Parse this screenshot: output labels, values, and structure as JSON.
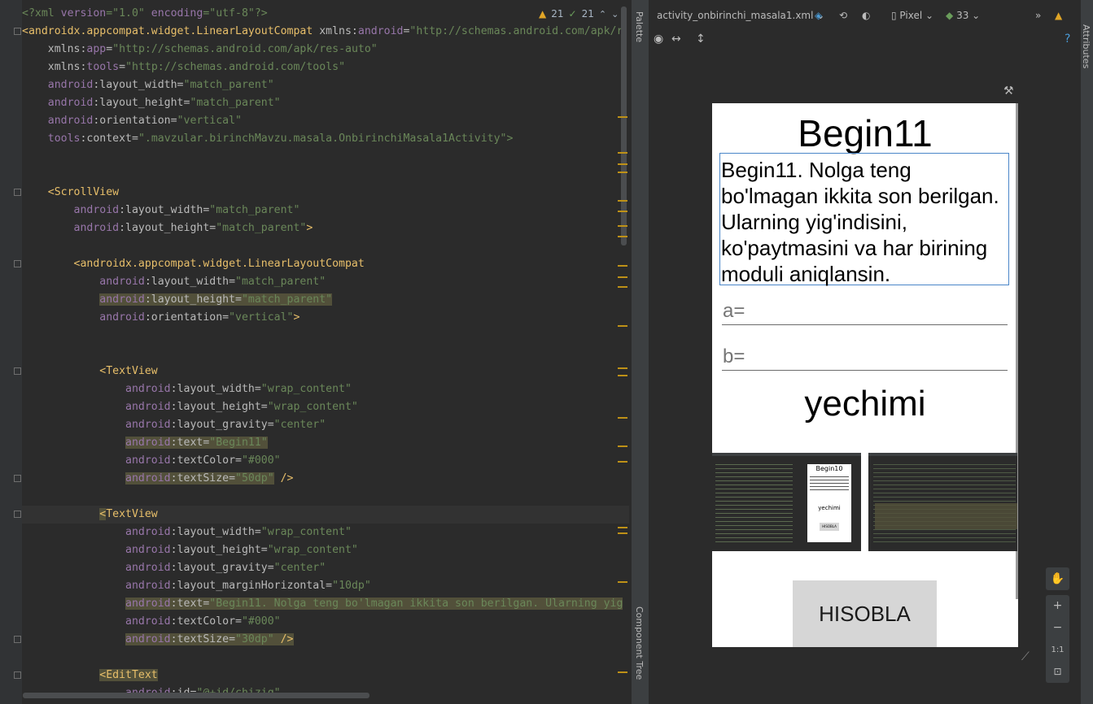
{
  "editor": {
    "warnings_count": "21",
    "weak_warnings_count": "21",
    "lines": [
      [
        [
          "t-str",
          "<?xml "
        ],
        [
          "t-ns",
          "version"
        ],
        [
          "t-str",
          "=\"1.0\" "
        ],
        [
          "t-ns",
          "encoding"
        ],
        [
          "t-str",
          "=\"utf-8\"?>"
        ]
      ],
      [
        [
          "t-tag",
          "<androidx.appcompat.widget.LinearLayoutCompat "
        ],
        [
          "t-attr",
          "xmlns:"
        ],
        [
          "t-ns",
          "android"
        ],
        [
          "t-attr",
          "="
        ],
        [
          "t-str",
          "\"http://schemas.android.com/apk/r"
        ]
      ],
      [
        [
          "t-plain",
          "    "
        ],
        [
          "t-attr",
          "xmlns:"
        ],
        [
          "t-ns",
          "app"
        ],
        [
          "t-attr",
          "="
        ],
        [
          "t-str",
          "\"http://schemas.android.com/apk/res-auto\""
        ]
      ],
      [
        [
          "t-plain",
          "    "
        ],
        [
          "t-attr",
          "xmlns:"
        ],
        [
          "t-ns",
          "tools"
        ],
        [
          "t-attr",
          "="
        ],
        [
          "t-str",
          "\"http://schemas.android.com/tools\""
        ]
      ],
      [
        [
          "t-plain",
          "    "
        ],
        [
          "t-ns",
          "android"
        ],
        [
          "t-attr",
          ":layout_width="
        ],
        [
          "t-str",
          "\"match_parent\""
        ]
      ],
      [
        [
          "t-plain",
          "    "
        ],
        [
          "t-ns",
          "android"
        ],
        [
          "t-attr",
          ":layout_height="
        ],
        [
          "t-str",
          "\"match_parent\""
        ]
      ],
      [
        [
          "t-plain",
          "    "
        ],
        [
          "t-ns",
          "android"
        ],
        [
          "t-attr",
          ":orientation="
        ],
        [
          "t-str",
          "\"vertical\""
        ]
      ],
      [
        [
          "t-plain",
          "    "
        ],
        [
          "t-ns",
          "tools"
        ],
        [
          "t-attr",
          ":context="
        ],
        [
          "t-str",
          "\".mavzular.birinchMavzu.masala.OnbirinchiMasala1Activity\">"
        ]
      ],
      [],
      [],
      [
        [
          "t-plain",
          "    "
        ],
        [
          "t-tag",
          "<ScrollView"
        ]
      ],
      [
        [
          "t-plain",
          "        "
        ],
        [
          "t-ns",
          "android"
        ],
        [
          "t-attr",
          ":layout_width="
        ],
        [
          "t-str",
          "\"match_parent\""
        ]
      ],
      [
        [
          "t-plain",
          "        "
        ],
        [
          "t-ns",
          "android"
        ],
        [
          "t-attr",
          ":layout_height="
        ],
        [
          "t-str",
          "\"match_parent\""
        ],
        [
          "t-tag",
          ">"
        ]
      ],
      [],
      [
        [
          "t-plain",
          "        "
        ],
        [
          "t-tag",
          "<androidx.appcompat.widget.LinearLayoutCompat"
        ]
      ],
      [
        [
          "t-plain",
          "            "
        ],
        [
          "t-ns",
          "android"
        ],
        [
          "t-attr",
          ":layout_width="
        ],
        [
          "t-str",
          "\"match_parent\""
        ]
      ],
      [
        [
          "t-plain",
          "            "
        ],
        [
          "t-ns hl",
          "android"
        ],
        [
          "t-attr hl",
          ":layout_height="
        ],
        [
          "t-str hl",
          "\"match_parent\""
        ]
      ],
      [
        [
          "t-plain",
          "            "
        ],
        [
          "t-ns",
          "android"
        ],
        [
          "t-attr",
          ":orientation="
        ],
        [
          "t-str",
          "\"vertical\""
        ],
        [
          "t-tag",
          ">"
        ]
      ],
      [],
      [],
      [
        [
          "t-plain",
          "            "
        ],
        [
          "t-tag",
          "<TextView"
        ]
      ],
      [
        [
          "t-plain",
          "                "
        ],
        [
          "t-ns",
          "android"
        ],
        [
          "t-attr",
          ":layout_width="
        ],
        [
          "t-str",
          "\"wrap_content\""
        ]
      ],
      [
        [
          "t-plain",
          "                "
        ],
        [
          "t-ns",
          "android"
        ],
        [
          "t-attr",
          ":layout_height="
        ],
        [
          "t-str",
          "\"wrap_content\""
        ]
      ],
      [
        [
          "t-plain",
          "                "
        ],
        [
          "t-ns",
          "android"
        ],
        [
          "t-attr",
          ":layout_gravity="
        ],
        [
          "t-str",
          "\"center\""
        ]
      ],
      [
        [
          "t-plain",
          "                "
        ],
        [
          "t-ns hl",
          "android"
        ],
        [
          "t-attr hl",
          ":text="
        ],
        [
          "t-str hl",
          "\"Begin11\""
        ]
      ],
      [
        [
          "t-plain",
          "                "
        ],
        [
          "t-ns",
          "android"
        ],
        [
          "t-attr",
          ":textColor="
        ],
        [
          "t-str",
          "\"#000\""
        ]
      ],
      [
        [
          "t-plain",
          "                "
        ],
        [
          "t-ns hl",
          "android"
        ],
        [
          "t-attr hl",
          ":textSize="
        ],
        [
          "t-str hl",
          "\"50dp\""
        ],
        [
          "t-tag",
          " />"
        ]
      ],
      [],
      [
        [
          "t-plain",
          "            "
        ],
        [
          "t-tag hl",
          "<"
        ],
        [
          "t-tag",
          "TextView"
        ]
      ],
      [
        [
          "t-plain",
          "                "
        ],
        [
          "t-ns",
          "android"
        ],
        [
          "t-attr",
          ":layout_width="
        ],
        [
          "t-str",
          "\"wrap_content\""
        ]
      ],
      [
        [
          "t-plain",
          "                "
        ],
        [
          "t-ns",
          "android"
        ],
        [
          "t-attr",
          ":layout_height="
        ],
        [
          "t-str",
          "\"wrap_content\""
        ]
      ],
      [
        [
          "t-plain",
          "                "
        ],
        [
          "t-ns",
          "android"
        ],
        [
          "t-attr",
          ":layout_gravity="
        ],
        [
          "t-str",
          "\"center\""
        ]
      ],
      [
        [
          "t-plain",
          "                "
        ],
        [
          "t-ns",
          "android"
        ],
        [
          "t-attr",
          ":layout_marginHorizontal="
        ],
        [
          "t-str",
          "\"10dp\""
        ]
      ],
      [
        [
          "t-plain",
          "                "
        ],
        [
          "t-ns hl",
          "android"
        ],
        [
          "t-attr hl",
          ":text="
        ],
        [
          "t-str hl",
          "\"Begin11. Nolga teng bo'lmagan ikkita son berilgan. Ularning yig"
        ]
      ],
      [
        [
          "t-plain",
          "                "
        ],
        [
          "t-ns",
          "android"
        ],
        [
          "t-attr",
          ":textColor="
        ],
        [
          "t-str",
          "\"#000\""
        ]
      ],
      [
        [
          "t-plain",
          "                "
        ],
        [
          "t-ns hl",
          "android"
        ],
        [
          "t-attr hl",
          ":textSize="
        ],
        [
          "t-str hl",
          "\"30dp\""
        ],
        [
          "t-tag hl",
          " />"
        ]
      ],
      [],
      [
        [
          "t-plain",
          "            "
        ],
        [
          "t-tag hl",
          "<EditText"
        ]
      ],
      [
        [
          "t-plain",
          "                "
        ],
        [
          "t-ns",
          "android"
        ],
        [
          "t-attr",
          ":id="
        ],
        [
          "t-str",
          "\"@+id/chiziq\""
        ]
      ]
    ]
  },
  "design": {
    "file_tab": "activity_onbirinchi_masala1.xml",
    "device": "Pixel",
    "api_level": "33",
    "palette_label": "Palette",
    "component_tree_label": "Component Tree",
    "attributes_label": "Attributes",
    "zoom_actual": "1:1"
  },
  "phone": {
    "title": "Begin11",
    "description": "Begin11. Nolga teng bo'lmagan ikkita son berilgan. Ularning yig'indisini, ko'paytmasini va har birining moduli aniqlansin.",
    "input_a_hint": "a=",
    "input_b_hint": "b=",
    "result_label": "yechimi",
    "button_label": "HISOBLA",
    "thumb_title": "Begin10",
    "thumb_result": "yechimi",
    "thumb_button": "HISOBLA"
  },
  "colors": {
    "editor_bg": "#2b2b2b",
    "tag": "#e8bf6a",
    "namespace": "#9876aa",
    "string": "#6a8759",
    "warning": "#e0a526",
    "selection_border": "#4a86c8"
  }
}
